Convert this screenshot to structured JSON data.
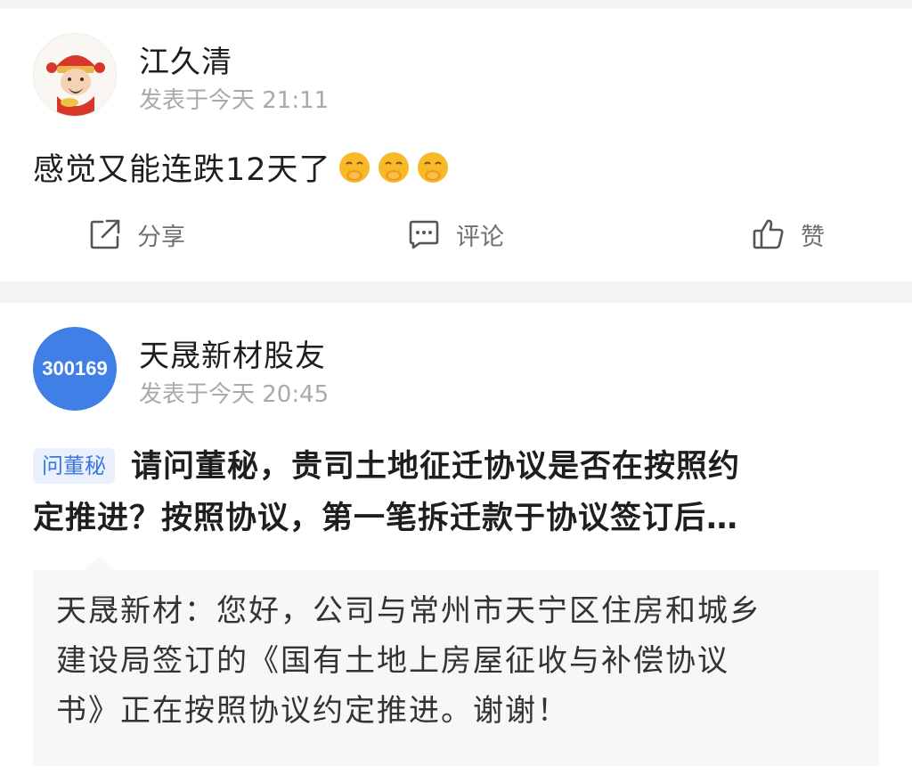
{
  "posts": [
    {
      "username": "江久清",
      "time": "发表于今天 21:11",
      "avatar_icon": "god-of-wealth-avatar-icon",
      "content": "感觉又能连跌12天了",
      "emojis": [
        "smiling-hands-emoji",
        "smiling-hands-emoji",
        "smiling-hands-emoji"
      ],
      "actions": {
        "share": "分享",
        "comment": "评论",
        "like": "赞"
      }
    },
    {
      "username": "天晟新材股友",
      "time": "发表于今天 20:45",
      "avatar_text": "300169",
      "avatar_color": "#3f7fe6",
      "question_tag": "问董秘",
      "question_line1": "请问董秘，贵司土地征迁协议是否在按照约",
      "question_line2": "定推进？按照协议，第一笔拆迁款于协议签订后…",
      "reply_line1": "天晟新材：您好，公司与常州市天宁区住房和城乡",
      "reply_line2": "建设局签订的《国有土地上房屋征收与补偿协议",
      "reply_line3": "书》正在按照协议约定推进。谢谢！"
    }
  ],
  "colors": {
    "tag_blue": "#3d78e0",
    "tag_bg": "#eaf1fd",
    "page_bg": "#f4f5f7"
  }
}
